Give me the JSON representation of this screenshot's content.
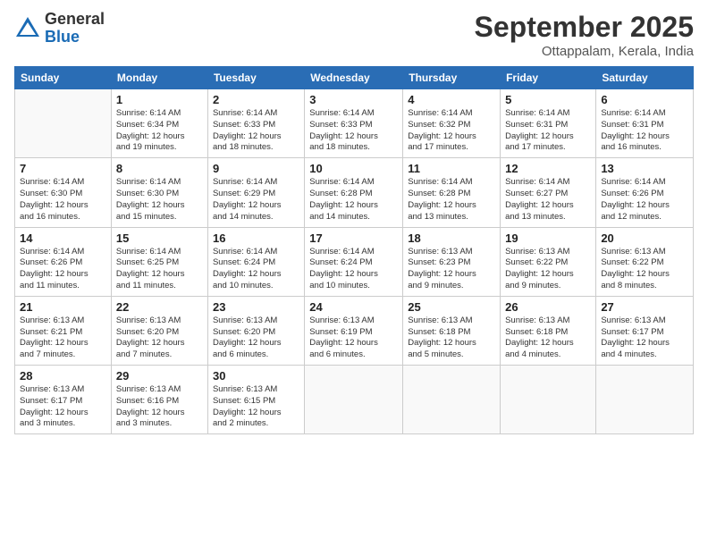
{
  "logo": {
    "general": "General",
    "blue": "Blue"
  },
  "title": "September 2025",
  "location": "Ottappalam, Kerala, India",
  "days_header": [
    "Sunday",
    "Monday",
    "Tuesday",
    "Wednesday",
    "Thursday",
    "Friday",
    "Saturday"
  ],
  "weeks": [
    [
      {
        "day": "",
        "info": ""
      },
      {
        "day": "1",
        "info": "Sunrise: 6:14 AM\nSunset: 6:34 PM\nDaylight: 12 hours\nand 19 minutes."
      },
      {
        "day": "2",
        "info": "Sunrise: 6:14 AM\nSunset: 6:33 PM\nDaylight: 12 hours\nand 18 minutes."
      },
      {
        "day": "3",
        "info": "Sunrise: 6:14 AM\nSunset: 6:33 PM\nDaylight: 12 hours\nand 18 minutes."
      },
      {
        "day": "4",
        "info": "Sunrise: 6:14 AM\nSunset: 6:32 PM\nDaylight: 12 hours\nand 17 minutes."
      },
      {
        "day": "5",
        "info": "Sunrise: 6:14 AM\nSunset: 6:31 PM\nDaylight: 12 hours\nand 17 minutes."
      },
      {
        "day": "6",
        "info": "Sunrise: 6:14 AM\nSunset: 6:31 PM\nDaylight: 12 hours\nand 16 minutes."
      }
    ],
    [
      {
        "day": "7",
        "info": "Sunrise: 6:14 AM\nSunset: 6:30 PM\nDaylight: 12 hours\nand 16 minutes."
      },
      {
        "day": "8",
        "info": "Sunrise: 6:14 AM\nSunset: 6:30 PM\nDaylight: 12 hours\nand 15 minutes."
      },
      {
        "day": "9",
        "info": "Sunrise: 6:14 AM\nSunset: 6:29 PM\nDaylight: 12 hours\nand 14 minutes."
      },
      {
        "day": "10",
        "info": "Sunrise: 6:14 AM\nSunset: 6:28 PM\nDaylight: 12 hours\nand 14 minutes."
      },
      {
        "day": "11",
        "info": "Sunrise: 6:14 AM\nSunset: 6:28 PM\nDaylight: 12 hours\nand 13 minutes."
      },
      {
        "day": "12",
        "info": "Sunrise: 6:14 AM\nSunset: 6:27 PM\nDaylight: 12 hours\nand 13 minutes."
      },
      {
        "day": "13",
        "info": "Sunrise: 6:14 AM\nSunset: 6:26 PM\nDaylight: 12 hours\nand 12 minutes."
      }
    ],
    [
      {
        "day": "14",
        "info": "Sunrise: 6:14 AM\nSunset: 6:26 PM\nDaylight: 12 hours\nand 11 minutes."
      },
      {
        "day": "15",
        "info": "Sunrise: 6:14 AM\nSunset: 6:25 PM\nDaylight: 12 hours\nand 11 minutes."
      },
      {
        "day": "16",
        "info": "Sunrise: 6:14 AM\nSunset: 6:24 PM\nDaylight: 12 hours\nand 10 minutes."
      },
      {
        "day": "17",
        "info": "Sunrise: 6:14 AM\nSunset: 6:24 PM\nDaylight: 12 hours\nand 10 minutes."
      },
      {
        "day": "18",
        "info": "Sunrise: 6:13 AM\nSunset: 6:23 PM\nDaylight: 12 hours\nand 9 minutes."
      },
      {
        "day": "19",
        "info": "Sunrise: 6:13 AM\nSunset: 6:22 PM\nDaylight: 12 hours\nand 9 minutes."
      },
      {
        "day": "20",
        "info": "Sunrise: 6:13 AM\nSunset: 6:22 PM\nDaylight: 12 hours\nand 8 minutes."
      }
    ],
    [
      {
        "day": "21",
        "info": "Sunrise: 6:13 AM\nSunset: 6:21 PM\nDaylight: 12 hours\nand 7 minutes."
      },
      {
        "day": "22",
        "info": "Sunrise: 6:13 AM\nSunset: 6:20 PM\nDaylight: 12 hours\nand 7 minutes."
      },
      {
        "day": "23",
        "info": "Sunrise: 6:13 AM\nSunset: 6:20 PM\nDaylight: 12 hours\nand 6 minutes."
      },
      {
        "day": "24",
        "info": "Sunrise: 6:13 AM\nSunset: 6:19 PM\nDaylight: 12 hours\nand 6 minutes."
      },
      {
        "day": "25",
        "info": "Sunrise: 6:13 AM\nSunset: 6:18 PM\nDaylight: 12 hours\nand 5 minutes."
      },
      {
        "day": "26",
        "info": "Sunrise: 6:13 AM\nSunset: 6:18 PM\nDaylight: 12 hours\nand 4 minutes."
      },
      {
        "day": "27",
        "info": "Sunrise: 6:13 AM\nSunset: 6:17 PM\nDaylight: 12 hours\nand 4 minutes."
      }
    ],
    [
      {
        "day": "28",
        "info": "Sunrise: 6:13 AM\nSunset: 6:17 PM\nDaylight: 12 hours\nand 3 minutes."
      },
      {
        "day": "29",
        "info": "Sunrise: 6:13 AM\nSunset: 6:16 PM\nDaylight: 12 hours\nand 3 minutes."
      },
      {
        "day": "30",
        "info": "Sunrise: 6:13 AM\nSunset: 6:15 PM\nDaylight: 12 hours\nand 2 minutes."
      },
      {
        "day": "",
        "info": ""
      },
      {
        "day": "",
        "info": ""
      },
      {
        "day": "",
        "info": ""
      },
      {
        "day": "",
        "info": ""
      }
    ]
  ]
}
